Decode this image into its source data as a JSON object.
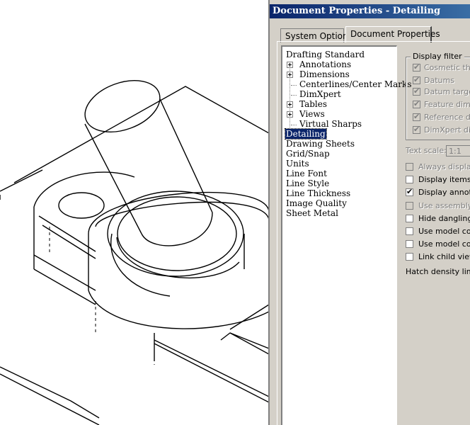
{
  "dialog": {
    "title": "Document Properties - Detailing",
    "tabs": [
      {
        "label": "System Options",
        "active": false
      },
      {
        "label": "Document Properties",
        "active": true
      }
    ],
    "tree": [
      {
        "label": "Drafting Standard",
        "level": 0,
        "expandable": false,
        "selected": false
      },
      {
        "label": "Annotations",
        "level": 1,
        "expandable": true,
        "selected": false
      },
      {
        "label": "Dimensions",
        "level": 1,
        "expandable": true,
        "selected": false
      },
      {
        "label": "Centerlines/Center Marks",
        "level": 1,
        "expandable": false,
        "selected": false
      },
      {
        "label": "DimXpert",
        "level": 1,
        "expandable": false,
        "selected": false
      },
      {
        "label": "Tables",
        "level": 1,
        "expandable": true,
        "selected": false
      },
      {
        "label": "Views",
        "level": 1,
        "expandable": true,
        "selected": false
      },
      {
        "label": "Virtual Sharps",
        "level": 1,
        "expandable": false,
        "selected": false
      },
      {
        "label": "Detailing",
        "level": 0,
        "expandable": false,
        "selected": true
      },
      {
        "label": "Drawing Sheets",
        "level": 0,
        "expandable": false,
        "selected": false
      },
      {
        "label": "Grid/Snap",
        "level": 0,
        "expandable": false,
        "selected": false
      },
      {
        "label": "Units",
        "level": 0,
        "expandable": false,
        "selected": false
      },
      {
        "label": "Line Font",
        "level": 0,
        "expandable": false,
        "selected": false
      },
      {
        "label": "Line Style",
        "level": 0,
        "expandable": false,
        "selected": false
      },
      {
        "label": "Line Thickness",
        "level": 0,
        "expandable": false,
        "selected": false
      },
      {
        "label": "Image Quality",
        "level": 0,
        "expandable": false,
        "selected": false
      },
      {
        "label": "Sheet Metal",
        "level": 0,
        "expandable": false,
        "selected": false
      }
    ],
    "display_filter": {
      "legend": "Display filter",
      "items": [
        {
          "label": "Cosmetic thr",
          "checked": true,
          "enabled": false
        },
        {
          "label": "Datums",
          "checked": true,
          "enabled": false
        },
        {
          "label": "Datum target",
          "checked": true,
          "enabled": false
        },
        {
          "label": "Feature dime",
          "checked": true,
          "enabled": false
        },
        {
          "label": "Reference di",
          "checked": true,
          "enabled": false
        },
        {
          "label": "DimXpert dim",
          "checked": true,
          "enabled": false
        }
      ]
    },
    "text_scale": {
      "label": "Text scale:",
      "value": "1:1"
    },
    "options": [
      {
        "label": "Always display",
        "checked": false,
        "enabled": false
      },
      {
        "label": "Display items o",
        "checked": false,
        "enabled": true
      },
      {
        "label": "Display annota",
        "checked": true,
        "enabled": true
      },
      {
        "label": "Use assembly s",
        "checked": false,
        "enabled": false
      },
      {
        "label": "Hide dangling",
        "checked": false,
        "enabled": true
      },
      {
        "label": "Use model colo",
        "checked": false,
        "enabled": true
      },
      {
        "label": "Use model colo",
        "checked": false,
        "enabled": true
      },
      {
        "label": "Link child view",
        "checked": false,
        "enabled": true
      }
    ],
    "hatch_label": "Hatch density limit",
    "colors": {
      "titlebar": "#0a246a",
      "face": "#d4d0c8",
      "selection": "#0a246a"
    }
  },
  "drawing": {
    "icons": [
      "part-drawing-isometric"
    ]
  }
}
